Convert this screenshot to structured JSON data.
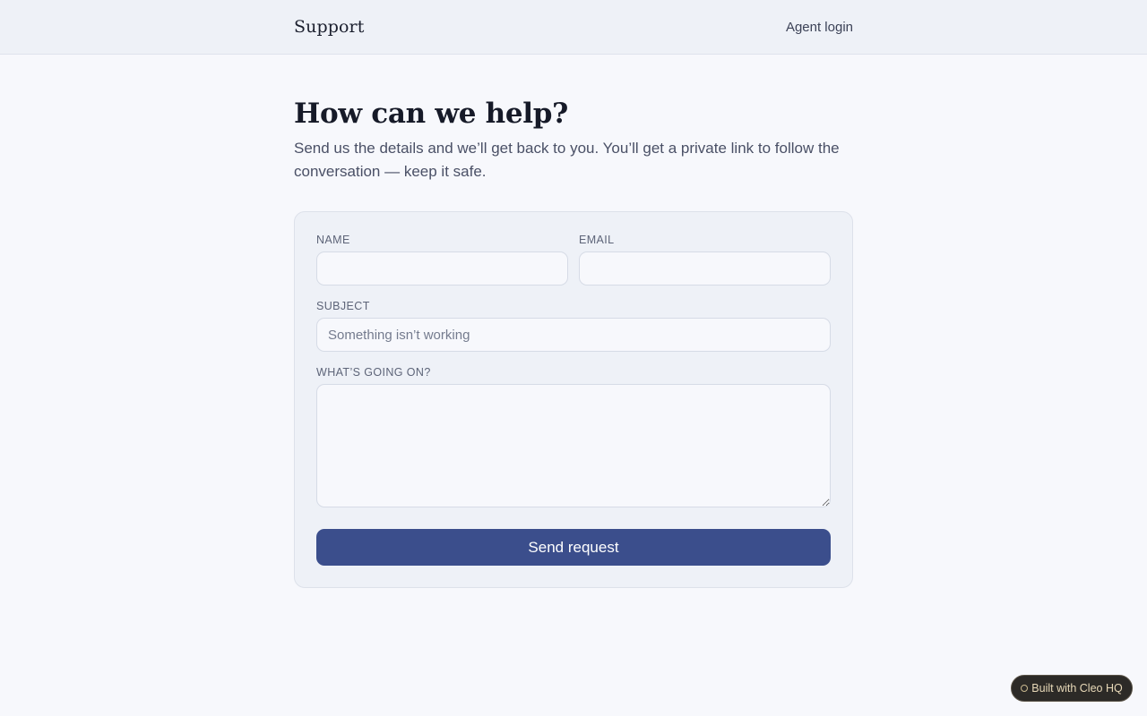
{
  "header": {
    "brand": "Support",
    "agent_login": "Agent login"
  },
  "hero": {
    "title": "How can we help?",
    "subtitle": "Send us the details and we’ll get back to you. You’ll get a private link to follow the conversation — keep it safe."
  },
  "form": {
    "name": {
      "label": "NAME",
      "value": "",
      "placeholder": ""
    },
    "email": {
      "label": "EMAIL",
      "value": "",
      "placeholder": ""
    },
    "subject": {
      "label": "SUBJECT",
      "value": "",
      "placeholder": "Something isn’t working"
    },
    "details": {
      "label": "WHAT’S GOING ON?",
      "value": "",
      "placeholder": ""
    },
    "submit_label": "Send request"
  },
  "badge": {
    "label": "Built with Cleo HQ",
    "icon": "circle-icon"
  },
  "colors": {
    "background": "#f7f8fc",
    "header_bg": "#eef1f7",
    "accent": "#3b4e8c",
    "badge_bg": "#2c2a27",
    "badge_text": "#e8d9b8"
  }
}
